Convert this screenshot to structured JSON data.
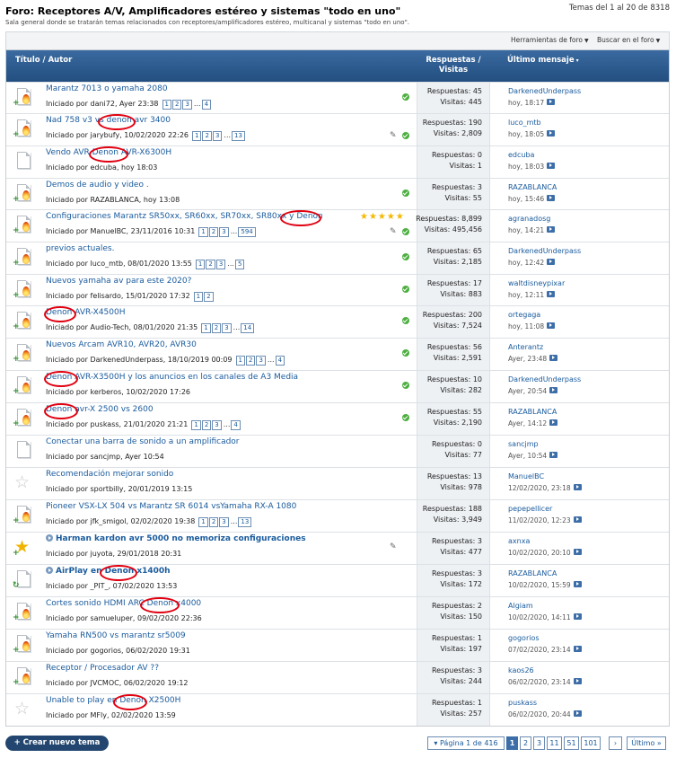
{
  "forum": {
    "title": "Foro: Receptores A/V, Amplificadores estéreo y sistemas \"todo en uno\"",
    "description": "Sala general donde se tratarán temas relacionados con receptores/amplificadores estéreo, multicanal y sistemas \"todo en uno\".",
    "count": "Temas del 1 al 20 de 8318"
  },
  "toolbar": {
    "tools_label": "Herramientas de foro",
    "search_label": "Buscar en el foro"
  },
  "columns": {
    "title": "Título / Autor",
    "stats_line1": "Respuestas /",
    "stats_line2": "Visitas",
    "last": "Último mensaje"
  },
  "threads": [
    {
      "icon": "hot",
      "title": "Marantz 7013 o yamaha 2080",
      "meta": "Iniciado por dani72, Ayer 23:38",
      "pages": [
        "1",
        "2",
        "3",
        "4"
      ],
      "check": true,
      "replies": "Respuestas: 45",
      "views": "Visitas: 445",
      "last_user": "DarkenedUnderpass",
      "last_date": "hoy, 18:17"
    },
    {
      "icon": "hot",
      "title": "Nad 758 v3 vs denon avr 3400",
      "meta": "Iniciado por jarybufy, 10/02/2020 22:26",
      "pages": [
        "1",
        "2",
        "3",
        "13"
      ],
      "check": true,
      "clip": true,
      "replies": "Respuestas: 190",
      "views": "Visitas: 2,809",
      "last_user": "luco_mtb",
      "last_date": "hoy, 18:05"
    },
    {
      "icon": "doc",
      "title": "Vendo AVR Denon AVR-X6300H",
      "meta": "Iniciado por edcuba, hoy 18:03",
      "pages": [],
      "check": false,
      "replies": "Respuestas: 0",
      "views": "Visitas: 1",
      "last_user": "edcuba",
      "last_date": "hoy, 18:03"
    },
    {
      "icon": "hot",
      "title": "Demos de audio y video .",
      "meta": "Iniciado por RAZABLANCA, hoy 13:08",
      "pages": [],
      "check": true,
      "replies": "Respuestas: 3",
      "views": "Visitas: 55",
      "last_user": "RAZABLANCA",
      "last_date": "hoy, 15:46"
    },
    {
      "icon": "hot",
      "title": "Configuraciones Marantz SR50xx, SR60xx, SR70xx, SR80xx y Denon",
      "meta": "Iniciado por ManuelBC, 23/11/2016 10:31",
      "pages": [
        "1",
        "2",
        "3",
        "594"
      ],
      "check": true,
      "clip": true,
      "stars": "★★★★★",
      "replies": "Respuestas: 8,899",
      "views": "Visitas: 495,456",
      "last_user": "agranadosg",
      "last_date": "hoy, 14:21"
    },
    {
      "icon": "hot",
      "title": "previos actuales.",
      "meta": "Iniciado por luco_mtb, 08/01/2020 13:55",
      "pages": [
        "1",
        "2",
        "3",
        "5"
      ],
      "check": true,
      "replies": "Respuestas: 65",
      "views": "Visitas: 2,185",
      "last_user": "DarkenedUnderpass",
      "last_date": "hoy, 12:42"
    },
    {
      "icon": "hot",
      "title": "Nuevos yamaha av para este 2020?",
      "meta": "Iniciado por felisardo, 15/01/2020 17:32",
      "pages": [
        "1",
        "2"
      ],
      "check": true,
      "replies": "Respuestas: 17",
      "views": "Visitas: 883",
      "last_user": "waltdisneypixar",
      "last_date": "hoy, 12:11"
    },
    {
      "icon": "hot",
      "title": "Denon AVR-X4500H",
      "meta": "Iniciado por Audio-Tech, 08/01/2020 21:35",
      "pages": [
        "1",
        "2",
        "3",
        "14"
      ],
      "check": true,
      "replies": "Respuestas: 200",
      "views": "Visitas: 7,524",
      "last_user": "ortegaga",
      "last_date": "hoy, 11:08"
    },
    {
      "icon": "hot",
      "title": "Nuevos Arcam AVR10, AVR20, AVR30",
      "meta": "Iniciado por DarkenedUnderpass, 18/10/2019 00:09",
      "pages": [
        "1",
        "2",
        "3",
        "4"
      ],
      "check": true,
      "replies": "Respuestas: 56",
      "views": "Visitas: 2,591",
      "last_user": "Anterantz",
      "last_date": "Ayer, 23:48"
    },
    {
      "icon": "hot",
      "title": "Denon AVR-X3500H y los anuncios en los canales de A3 Media",
      "meta": "Iniciado por kerberos, 10/02/2020 17:26",
      "pages": [],
      "check": true,
      "replies": "Respuestas: 10",
      "views": "Visitas: 282",
      "last_user": "DarkenedUnderpass",
      "last_date": "Ayer, 20:54"
    },
    {
      "icon": "hot",
      "title": "Denon avr-X 2500 vs 2600",
      "meta": "Iniciado por puskass, 21/01/2020 21:21",
      "pages": [
        "1",
        "2",
        "3",
        "4"
      ],
      "check": true,
      "replies": "Respuestas: 55",
      "views": "Visitas: 2,190",
      "last_user": "RAZABLANCA",
      "last_date": "Ayer, 14:12"
    },
    {
      "icon": "doc",
      "title": "Conectar una barra de sonido a un amplificador",
      "meta": "Iniciado por sancjmp, Ayer 10:54",
      "pages": [],
      "check": false,
      "replies": "Respuestas: 0",
      "views": "Visitas: 77",
      "last_user": "sancjmp",
      "last_date": "Ayer, 10:54"
    },
    {
      "icon": "star",
      "title": "Recomendación mejorar sonido",
      "meta": "Iniciado por sportbilly, 20/01/2019 13:15",
      "pages": [],
      "check": false,
      "replies": "Respuestas: 13",
      "views": "Visitas: 978",
      "last_user": "ManuelBC",
      "last_date": "12/02/2020, 23:18"
    },
    {
      "icon": "hot",
      "title": "Pioneer VSX-LX 504 vs Marantz SR 6014 vsYamaha RX-A 1080",
      "meta": "Iniciado por jfk_smigol, 02/02/2020 19:38",
      "pages": [
        "1",
        "2",
        "3",
        "13"
      ],
      "check": false,
      "replies": "Respuestas: 188",
      "views": "Visitas: 3,949",
      "last_user": "pepepellicer",
      "last_date": "11/02/2020, 12:23"
    },
    {
      "icon": "star-gold",
      "title": "Harman kardon avr 5000 no memoriza configuraciones",
      "bold": true,
      "bullet": true,
      "meta": "Iniciado por juyota, 29/01/2018 20:31",
      "pages": [],
      "check": false,
      "clip": true,
      "replies": "Respuestas: 3",
      "views": "Visitas: 477",
      "last_user": "axnxa",
      "last_date": "10/02/2020, 20:10"
    },
    {
      "icon": "doc-arrow",
      "title": "AirPlay en Denon x1400h",
      "bold": true,
      "bullet": true,
      "meta": "Iniciado por _PIT_, 07/02/2020 13:53",
      "pages": [],
      "check": false,
      "replies": "Respuestas: 3",
      "views": "Visitas: 172",
      "last_user": "RAZABLANCA",
      "last_date": "10/02/2020, 15:59"
    },
    {
      "icon": "hot",
      "title": "Cortes sonido HDMI ARC Denon x4000",
      "meta": "Iniciado por samueluper, 09/02/2020 22:36",
      "pages": [],
      "check": false,
      "replies": "Respuestas: 2",
      "views": "Visitas: 150",
      "last_user": "Algiam",
      "last_date": "10/02/2020, 14:11"
    },
    {
      "icon": "hot",
      "title": "Yamaha RN500 vs marantz sr5009",
      "meta": "Iniciado por gogorios, 06/02/2020 19:31",
      "pages": [],
      "check": false,
      "replies": "Respuestas: 1",
      "views": "Visitas: 197",
      "last_user": "gogorios",
      "last_date": "07/02/2020, 23:14"
    },
    {
      "icon": "hot",
      "title": "Receptor / Procesador AV ??",
      "meta": "Iniciado por JVCMOC, 06/02/2020 19:12",
      "pages": [],
      "check": false,
      "replies": "Respuestas: 3",
      "views": "Visitas: 244",
      "last_user": "kaos26",
      "last_date": "06/02/2020, 23:14"
    },
    {
      "icon": "star",
      "title": "Unable to play en Denon X2500H",
      "meta": "Iniciado por MFly, 02/02/2020 13:59",
      "pages": [],
      "check": false,
      "replies": "Respuestas: 1",
      "views": "Visitas: 257",
      "last_user": "puskass",
      "last_date": "06/02/2020, 20:44"
    }
  ],
  "footer": {
    "new_thread": "+ Crear nuevo tema",
    "page_of": "▾ Página 1 de 416",
    "pages": [
      "1",
      "2",
      "3",
      "11",
      "51",
      "101"
    ],
    "next": "›",
    "last": "Último »"
  }
}
